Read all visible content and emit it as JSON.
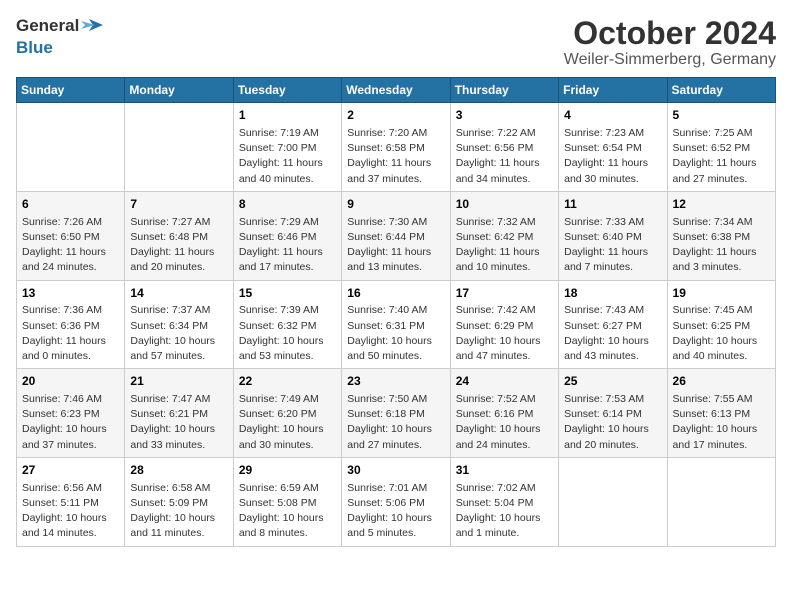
{
  "header": {
    "logo_general": "General",
    "logo_blue": "Blue",
    "month": "October 2024",
    "location": "Weiler-Simmerberg, Germany"
  },
  "weekdays": [
    "Sunday",
    "Monday",
    "Tuesday",
    "Wednesday",
    "Thursday",
    "Friday",
    "Saturday"
  ],
  "weeks": [
    [
      {
        "day": "",
        "info": ""
      },
      {
        "day": "",
        "info": ""
      },
      {
        "day": "1",
        "info": "Sunrise: 7:19 AM\nSunset: 7:00 PM\nDaylight: 11 hours and 40 minutes."
      },
      {
        "day": "2",
        "info": "Sunrise: 7:20 AM\nSunset: 6:58 PM\nDaylight: 11 hours and 37 minutes."
      },
      {
        "day": "3",
        "info": "Sunrise: 7:22 AM\nSunset: 6:56 PM\nDaylight: 11 hours and 34 minutes."
      },
      {
        "day": "4",
        "info": "Sunrise: 7:23 AM\nSunset: 6:54 PM\nDaylight: 11 hours and 30 minutes."
      },
      {
        "day": "5",
        "info": "Sunrise: 7:25 AM\nSunset: 6:52 PM\nDaylight: 11 hours and 27 minutes."
      }
    ],
    [
      {
        "day": "6",
        "info": "Sunrise: 7:26 AM\nSunset: 6:50 PM\nDaylight: 11 hours and 24 minutes."
      },
      {
        "day": "7",
        "info": "Sunrise: 7:27 AM\nSunset: 6:48 PM\nDaylight: 11 hours and 20 minutes."
      },
      {
        "day": "8",
        "info": "Sunrise: 7:29 AM\nSunset: 6:46 PM\nDaylight: 11 hours and 17 minutes."
      },
      {
        "day": "9",
        "info": "Sunrise: 7:30 AM\nSunset: 6:44 PM\nDaylight: 11 hours and 13 minutes."
      },
      {
        "day": "10",
        "info": "Sunrise: 7:32 AM\nSunset: 6:42 PM\nDaylight: 11 hours and 10 minutes."
      },
      {
        "day": "11",
        "info": "Sunrise: 7:33 AM\nSunset: 6:40 PM\nDaylight: 11 hours and 7 minutes."
      },
      {
        "day": "12",
        "info": "Sunrise: 7:34 AM\nSunset: 6:38 PM\nDaylight: 11 hours and 3 minutes."
      }
    ],
    [
      {
        "day": "13",
        "info": "Sunrise: 7:36 AM\nSunset: 6:36 PM\nDaylight: 11 hours and 0 minutes."
      },
      {
        "day": "14",
        "info": "Sunrise: 7:37 AM\nSunset: 6:34 PM\nDaylight: 10 hours and 57 minutes."
      },
      {
        "day": "15",
        "info": "Sunrise: 7:39 AM\nSunset: 6:32 PM\nDaylight: 10 hours and 53 minutes."
      },
      {
        "day": "16",
        "info": "Sunrise: 7:40 AM\nSunset: 6:31 PM\nDaylight: 10 hours and 50 minutes."
      },
      {
        "day": "17",
        "info": "Sunrise: 7:42 AM\nSunset: 6:29 PM\nDaylight: 10 hours and 47 minutes."
      },
      {
        "day": "18",
        "info": "Sunrise: 7:43 AM\nSunset: 6:27 PM\nDaylight: 10 hours and 43 minutes."
      },
      {
        "day": "19",
        "info": "Sunrise: 7:45 AM\nSunset: 6:25 PM\nDaylight: 10 hours and 40 minutes."
      }
    ],
    [
      {
        "day": "20",
        "info": "Sunrise: 7:46 AM\nSunset: 6:23 PM\nDaylight: 10 hours and 37 minutes."
      },
      {
        "day": "21",
        "info": "Sunrise: 7:47 AM\nSunset: 6:21 PM\nDaylight: 10 hours and 33 minutes."
      },
      {
        "day": "22",
        "info": "Sunrise: 7:49 AM\nSunset: 6:20 PM\nDaylight: 10 hours and 30 minutes."
      },
      {
        "day": "23",
        "info": "Sunrise: 7:50 AM\nSunset: 6:18 PM\nDaylight: 10 hours and 27 minutes."
      },
      {
        "day": "24",
        "info": "Sunrise: 7:52 AM\nSunset: 6:16 PM\nDaylight: 10 hours and 24 minutes."
      },
      {
        "day": "25",
        "info": "Sunrise: 7:53 AM\nSunset: 6:14 PM\nDaylight: 10 hours and 20 minutes."
      },
      {
        "day": "26",
        "info": "Sunrise: 7:55 AM\nSunset: 6:13 PM\nDaylight: 10 hours and 17 minutes."
      }
    ],
    [
      {
        "day": "27",
        "info": "Sunrise: 6:56 AM\nSunset: 5:11 PM\nDaylight: 10 hours and 14 minutes."
      },
      {
        "day": "28",
        "info": "Sunrise: 6:58 AM\nSunset: 5:09 PM\nDaylight: 10 hours and 11 minutes."
      },
      {
        "day": "29",
        "info": "Sunrise: 6:59 AM\nSunset: 5:08 PM\nDaylight: 10 hours and 8 minutes."
      },
      {
        "day": "30",
        "info": "Sunrise: 7:01 AM\nSunset: 5:06 PM\nDaylight: 10 hours and 5 minutes."
      },
      {
        "day": "31",
        "info": "Sunrise: 7:02 AM\nSunset: 5:04 PM\nDaylight: 10 hours and 1 minute."
      },
      {
        "day": "",
        "info": ""
      },
      {
        "day": "",
        "info": ""
      }
    ]
  ]
}
